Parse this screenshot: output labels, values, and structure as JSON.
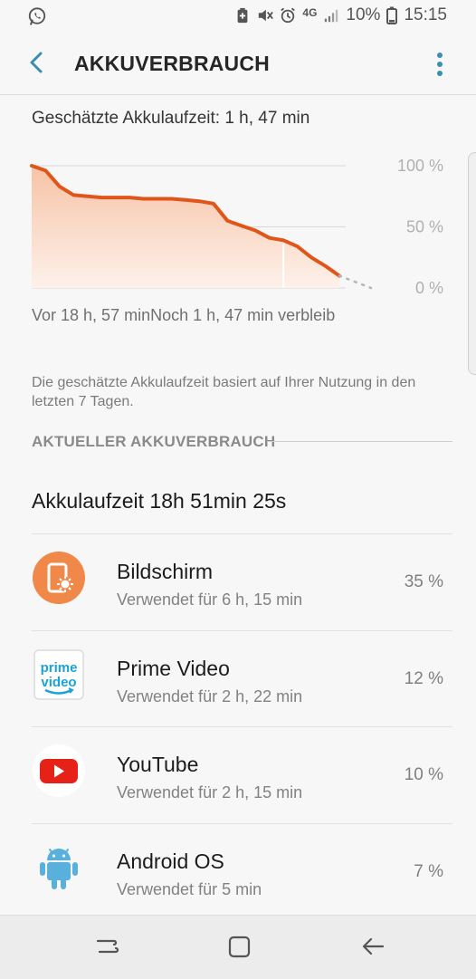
{
  "status": {
    "signal_label": "4G",
    "battery": "10%",
    "time": "15:15",
    "icons": [
      "whatsapp-icon",
      "battery-saver-icon",
      "mute-icon",
      "alarm-icon",
      "signal-icon",
      "battery-icon"
    ]
  },
  "header": {
    "title": "AKKUVERBRAUCH",
    "back_icon": "back-arrow-icon",
    "more_icon": "more-vert-icon"
  },
  "estimate": {
    "text": "Geschätzte Akkulaufzeit: 1 h, 47 min"
  },
  "chart_data": {
    "type": "area",
    "y_ticks": [
      "100 %",
      "50 %",
      "0 %"
    ],
    "ylim": [
      0,
      100
    ],
    "series": [
      {
        "values": [
          100,
          96,
          83,
          76,
          75,
          74,
          74,
          74,
          73,
          73,
          73,
          72,
          71,
          69,
          55,
          51,
          47,
          41,
          39,
          34,
          25,
          18,
          10
        ]
      }
    ],
    "projection": [
      10,
      0
    ],
    "start_caption": "Vor 18 h, 57 min",
    "end_caption": "Noch 1 h, 47 min verbleib",
    "colors": {
      "line": "#e0561a",
      "fill_top": "#f7c3a6",
      "fill_bottom": "#fdf1ea",
      "grid": "#d8d8d8"
    }
  },
  "note": "Die geschätzte Akkulaufzeit basiert auf Ihrer Nutzung in den letzten 7 Tagen.",
  "section": {
    "title": "AKTUELLER AKKUVERBRAUCH"
  },
  "total": "Akkulaufzeit 18h 51min 25s",
  "apps": [
    {
      "name": "Bildschirm",
      "usage": "Verwendet für 6 h, 15 min",
      "percent": "35 %",
      "icon": "display-icon",
      "icon_color": "#f0884a"
    },
    {
      "name": "Prime Video",
      "usage": "Verwendet für 2 h, 22 min",
      "percent": "12 %",
      "icon": "prime-video-icon",
      "icon_text_top": "prime",
      "icon_text_bottom": "video",
      "icon_color": "#1aa3d8"
    },
    {
      "name": "YouTube",
      "usage": "Verwendet für 2 h, 15 min",
      "percent": "10 %",
      "icon": "youtube-icon",
      "icon_color": "#e62117"
    },
    {
      "name": "Android OS",
      "usage": "Verwendet für 5 min",
      "percent": "7 %",
      "icon": "android-icon",
      "icon_color": "#5ab0dd"
    }
  ],
  "navbar": {
    "icons": [
      "recent-apps-icon",
      "home-icon",
      "back-icon"
    ]
  }
}
